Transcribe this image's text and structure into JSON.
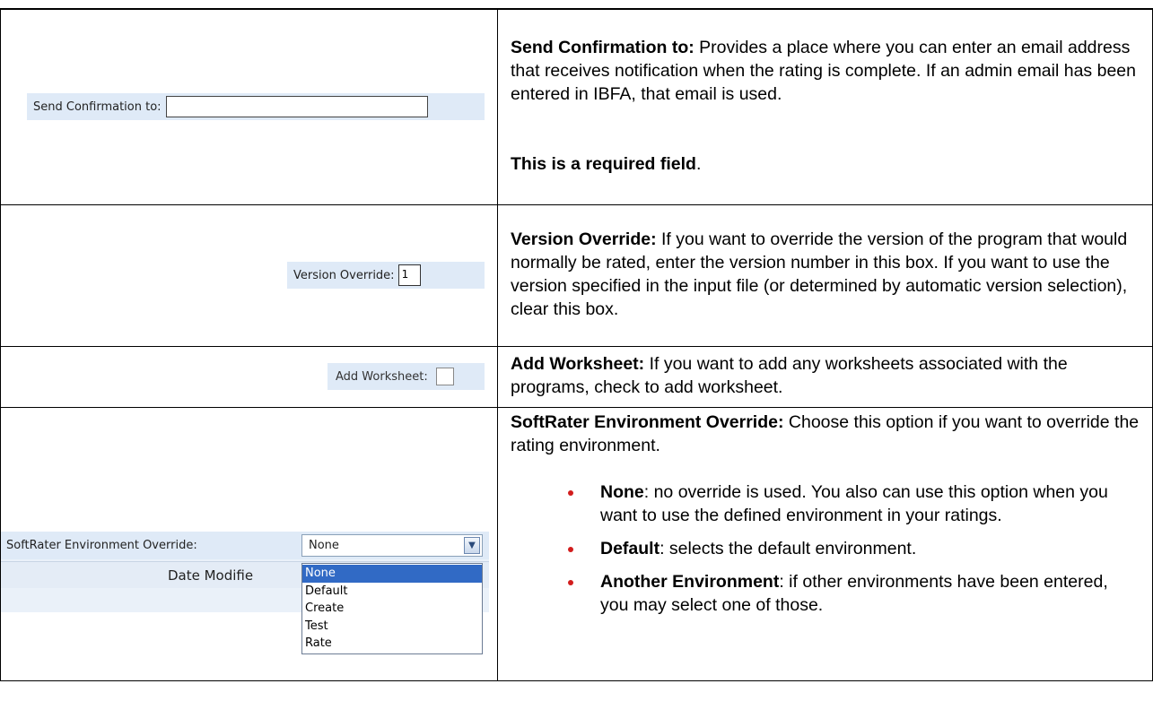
{
  "rows": [
    {
      "snippet_label": "Send Confirmation to:",
      "term": "Send Confirmation to:",
      "description": "Provides a place where you can enter an email address that receives notification when the rating is complete. If an admin email has been entered in IBFA, that email is used.",
      "required_note": "This is a required field"
    },
    {
      "snippet_label": "Version Override:",
      "snippet_value": "1",
      "term": "Version Override:",
      "description": "If you want to override the version of the program that would normally be rated, enter the version number in this box. If you want to use the version specified in the input file (or determined by automatic version selection), clear this box."
    },
    {
      "snippet_label": "Add Worksheet:",
      "term": "Add Worksheet:",
      "description": "If you want to add any worksheets associated with the programs, check to add worksheet."
    },
    {
      "snippet_label": "SoftRater Environment Override:",
      "snippet_selected": "None",
      "snippet_header": "Date Modifie",
      "snippet_options": [
        "None",
        "Default",
        "Create",
        "Test",
        "Rate"
      ],
      "term": "SoftRater Environment Override:",
      "description": "Choose this option if you want to override the rating environment.",
      "bullets": [
        {
          "term": "None",
          "text": ": no override is used. You also can use this option when you want to use the defined environment in your ratings."
        },
        {
          "term": "Default",
          "text": ": selects the default environment."
        },
        {
          "term": "Another Environment",
          "text": ": if other environments have been entered, you may select one of those."
        }
      ]
    }
  ],
  "colors": {
    "snippet_background": "#dfeaf7",
    "bullet": "#d21d1d",
    "dropdown_highlight": "#316ac5"
  },
  "icons": {
    "dropdown_arrow": "chevron-down-icon",
    "bullet": "bullet-dot-icon"
  }
}
